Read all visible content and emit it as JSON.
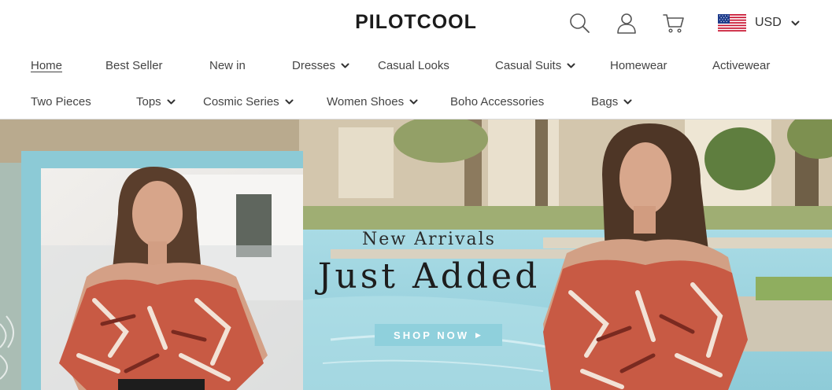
{
  "header": {
    "logo": "PILOTCOOL",
    "icons": [
      "search-icon",
      "user-icon",
      "cart-icon"
    ],
    "currency": {
      "flag": "us-flag-icon",
      "code": "USD"
    }
  },
  "nav": {
    "row1": [
      {
        "label": "Home",
        "dropdown": false,
        "active": true
      },
      {
        "label": "Best Seller",
        "dropdown": false
      },
      {
        "label": "New in",
        "dropdown": false
      },
      {
        "label": "Dresses",
        "dropdown": true
      },
      {
        "label": "Casual Looks",
        "dropdown": false
      },
      {
        "label": "Casual Suits",
        "dropdown": true
      },
      {
        "label": "Homewear",
        "dropdown": false
      },
      {
        "label": "Activewear",
        "dropdown": false
      }
    ],
    "row2": [
      {
        "label": "Two Pieces",
        "dropdown": false
      },
      {
        "label": "Tops",
        "dropdown": true
      },
      {
        "label": "Cosmic Series",
        "dropdown": true
      },
      {
        "label": "Women Shoes",
        "dropdown": true
      },
      {
        "label": "Boho Accessories",
        "dropdown": false
      },
      {
        "label": "Bags",
        "dropdown": true
      }
    ]
  },
  "hero": {
    "subtitle": "New Arrivals",
    "title": "Just Added",
    "cta": "SHOP NOW",
    "cta_icon": "play-icon"
  },
  "colors": {
    "cta_bg": "#8fd0dc",
    "frame": "#8ccad6",
    "pool": "#9ed3df"
  }
}
